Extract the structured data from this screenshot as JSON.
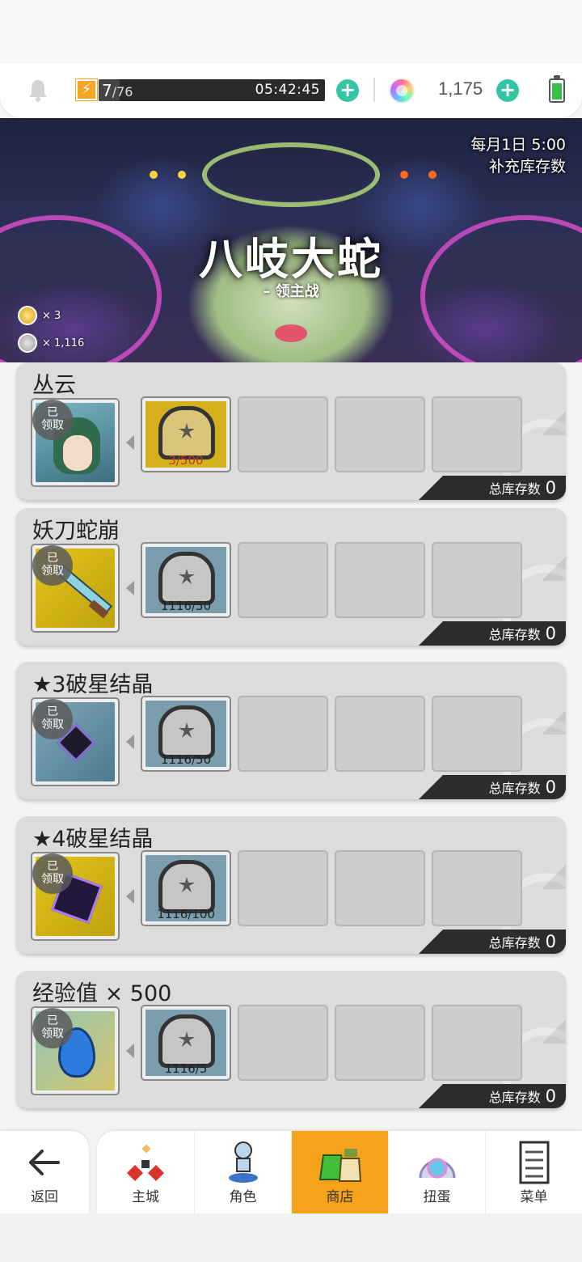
{
  "status_bar": {
    "stamina_current": "7",
    "stamina_max": "/76",
    "stamina_fraction": 0.092,
    "timer": "05:42:45",
    "gems": "1,175"
  },
  "banner": {
    "title": "八岐大蛇",
    "subtitle": "领主战",
    "restock_line1": "每月1日 5:00",
    "restock_line2": "补充库存数",
    "gold_coin_count": "× 3",
    "silver_coin_count": "× 1,116"
  },
  "rewards": [
    {
      "title": "丛云",
      "claimed": "已\n领取",
      "cost": "3/500",
      "stock_label": "总库存数",
      "stock": "0"
    },
    {
      "title": "妖刀蛇崩",
      "claimed": "已\n领取",
      "cost": "1116/50",
      "stock_label": "总库存数",
      "stock": "0"
    },
    {
      "title": "★3破星结晶",
      "claimed": "已\n领取",
      "cost": "1116/50",
      "stock_label": "总库存数",
      "stock": "0"
    },
    {
      "title": "★4破星结晶",
      "claimed": "已\n领取",
      "cost": "1116/100",
      "stock_label": "总库存数",
      "stock": "0"
    },
    {
      "title": "经验值 × 500",
      "claimed": "已\n领取",
      "cost": "1116/5",
      "stock_label": "总库存数",
      "stock": "0"
    }
  ],
  "nav": {
    "back": "返回",
    "tabs": [
      "主城",
      "角色",
      "商店",
      "扭蛋",
      "菜单"
    ],
    "active_tab": "商店"
  },
  "colors": {
    "accent_green": "#34c6a4",
    "active_tab": "#f7a21b",
    "cost_insufficient": "#c0392b"
  }
}
